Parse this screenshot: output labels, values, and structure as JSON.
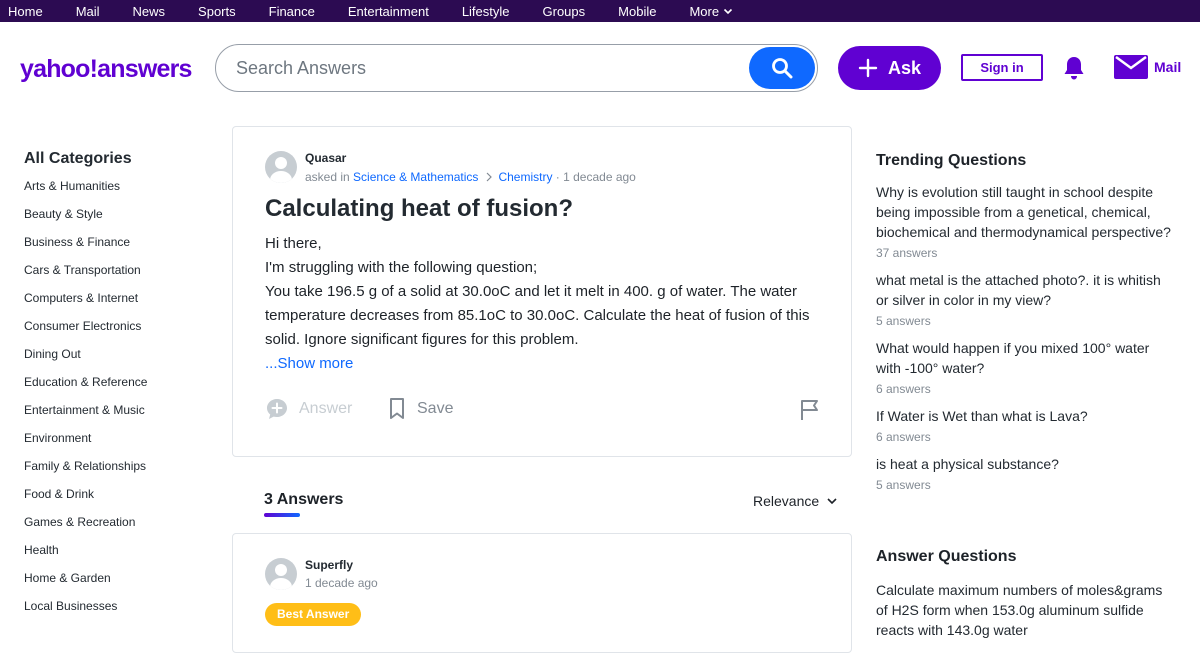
{
  "topnav": {
    "items": [
      "Home",
      "Mail",
      "News",
      "Sports",
      "Finance",
      "Entertainment",
      "Lifestyle",
      "Groups",
      "Mobile",
      "More"
    ]
  },
  "header": {
    "logo": "yahoo!answers",
    "search_placeholder": "Search Answers",
    "ask_label": "Ask",
    "signin_label": "Sign in",
    "mail_label": "Mail"
  },
  "sidebar": {
    "title": "All Categories",
    "categories": [
      "Arts & Humanities",
      "Beauty & Style",
      "Business & Finance",
      "Cars & Transportation",
      "Computers & Internet",
      "Consumer Electronics",
      "Dining Out",
      "Education & Reference",
      "Entertainment & Music",
      "Environment",
      "Family & Relationships",
      "Food & Drink",
      "Games & Recreation",
      "Health",
      "Home & Garden",
      "Local Businesses"
    ]
  },
  "question": {
    "author": "Quasar",
    "asked_in": "asked in",
    "category": "Science & Mathematics",
    "subcategory": "Chemistry",
    "time": "· 1 decade ago",
    "title": "Calculating heat of fusion?",
    "body": [
      "Hi there,",
      "I'm struggling with the following question;",
      "You take 196.5 g of a solid at 30.0oC and let it melt in 400. g of water. The water temperature decreases from 85.1oC to 30.0oC. Calculate the heat of fusion of this solid. Ignore significant figures for this problem."
    ],
    "show_more": "...Show more",
    "answer_label": "Answer",
    "save_label": "Save"
  },
  "answers_section": {
    "count_label": "3 Answers",
    "sort_label": "Relevance"
  },
  "top_answer": {
    "author": "Superfly",
    "time": "1 decade ago",
    "badge": "Best Answer"
  },
  "trending": {
    "title": "Trending Questions",
    "items": [
      {
        "question": "Why is evolution still taught in school despite being impossible from a genetical, chemical, biochemical and thermodynamical perspective?",
        "answers": "37 answers"
      },
      {
        "question": "what metal is the attached photo?. it is whitish or silver in color in my view?",
        "answers": "5 answers"
      },
      {
        "question": "What would happen if you mixed 100° water with -100° water?",
        "answers": "6 answers"
      },
      {
        "question": "If Water is Wet than what is Lava?",
        "answers": "6 answers"
      },
      {
        "question": "is heat a physical substance?",
        "answers": "5 answers"
      }
    ]
  },
  "answer_questions": {
    "title": "Answer Questions",
    "first_item": "Calculate maximum numbers of moles&grams of H2S form when 153.0g aluminum sulfide reacts with 143.0g water"
  },
  "colors": {
    "nav_bg": "#2c0b52",
    "brand_purple": "#6001d2",
    "link_blue": "#0f69ff",
    "best_answer_yellow": "#ffbe17"
  }
}
